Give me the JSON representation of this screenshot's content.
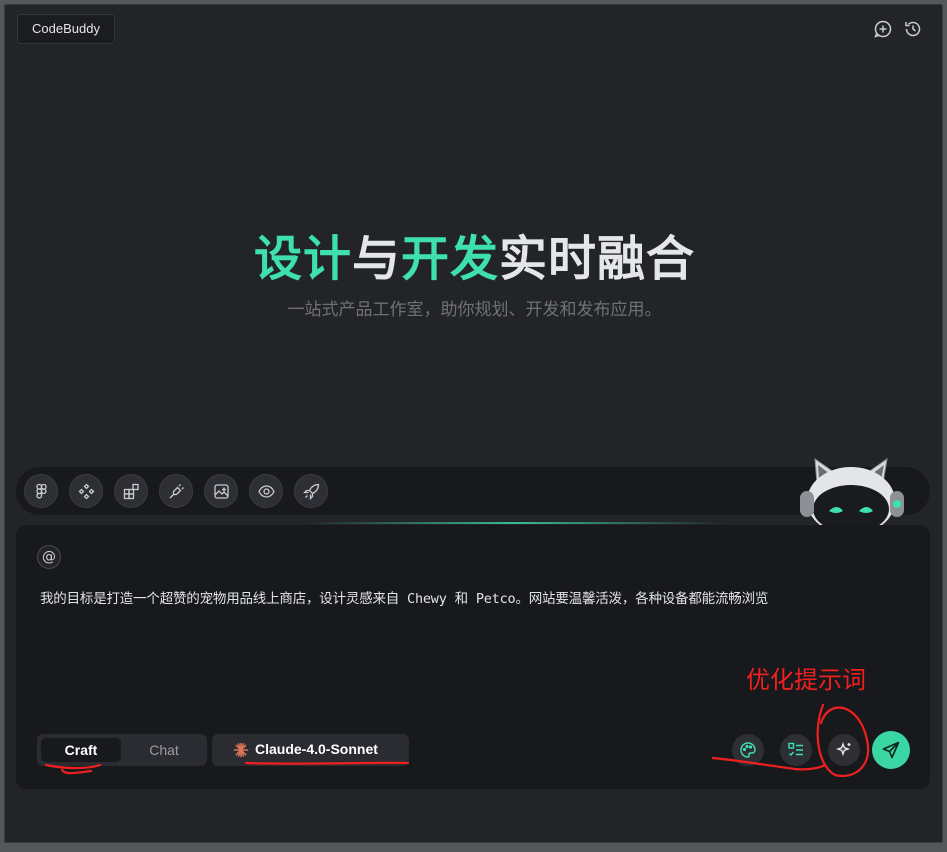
{
  "app": {
    "title": "CodeBuddy"
  },
  "header_icons": [
    {
      "name": "new-chat-icon"
    },
    {
      "name": "history-icon"
    }
  ],
  "hero": {
    "title_parts": [
      {
        "text": "设计",
        "color": "#3ee0b0"
      },
      {
        "text": "与",
        "color": "#e4e6ea"
      },
      {
        "text": "开发",
        "color": "#3ee0b0"
      },
      {
        "text": "实时融合",
        "color": "#e4e6ea"
      }
    ],
    "subtitle": "一站式产品工作室，助你规划、开发和发布应用。"
  },
  "toolbar": {
    "items": [
      {
        "name": "figma-icon"
      },
      {
        "name": "components-icon"
      },
      {
        "name": "blocks-icon"
      },
      {
        "name": "plug-icon"
      },
      {
        "name": "image-icon"
      },
      {
        "name": "preview-eye-icon"
      },
      {
        "name": "deploy-rocket-icon"
      }
    ]
  },
  "input": {
    "mention_symbol": "@",
    "prompt": "我的目标是打造一个超赞的宠物用品线上商店，设计灵感来自 Chewy 和 Petco。网站要温馨活泼，各种设备都能流畅浏览"
  },
  "modes": {
    "active": "Craft",
    "inactive": "Chat"
  },
  "model": {
    "label": "Claude-4.0-Sonnet",
    "icon": "claude-sparkle-icon"
  },
  "actions": [
    {
      "name": "palette-icon"
    },
    {
      "name": "checklist-icon"
    },
    {
      "name": "sparkle-enhance-icon"
    },
    {
      "name": "send-icon"
    }
  ],
  "annotation": {
    "text": "优化提示词",
    "color": "#f02020"
  },
  "colors": {
    "accent": "#3ad7a4",
    "background": "#232428",
    "panel": "#18191d"
  }
}
